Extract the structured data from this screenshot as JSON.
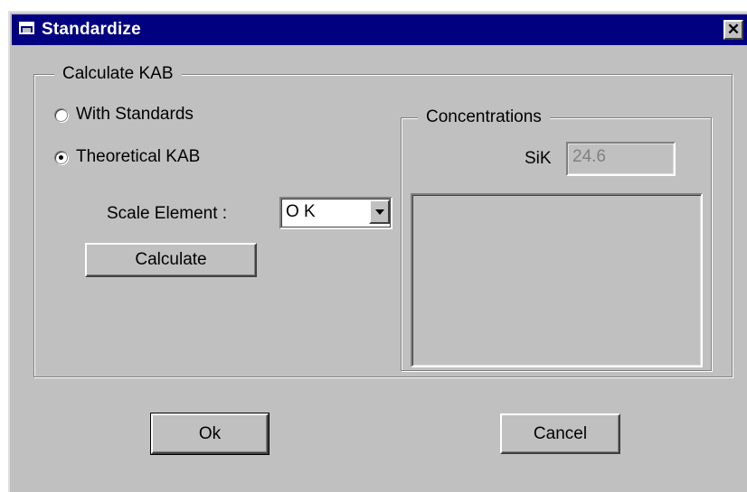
{
  "window": {
    "title": "Standardize",
    "close_glyph": "✕"
  },
  "calculate_group": {
    "legend": "Calculate KAB",
    "radio_with_standards": "With Standards",
    "radio_theoretical": "Theoretical KAB",
    "selected_option": "Theoretical KAB",
    "scale_element_label": "Scale Element :",
    "scale_element_value": "O K",
    "calculate_label": "Calculate"
  },
  "concentrations_group": {
    "legend": "Concentrations",
    "element_label": "SiK",
    "element_value": "24.6"
  },
  "footer": {
    "ok_label": "Ok",
    "cancel_label": "Cancel"
  },
  "icons": {
    "window": "window-icon",
    "close": "close-icon",
    "dropdown": "chevron-down-icon"
  },
  "colors": {
    "titlebar": "#000080",
    "face": "#c0c0c0",
    "disabled_text": "#808080"
  }
}
